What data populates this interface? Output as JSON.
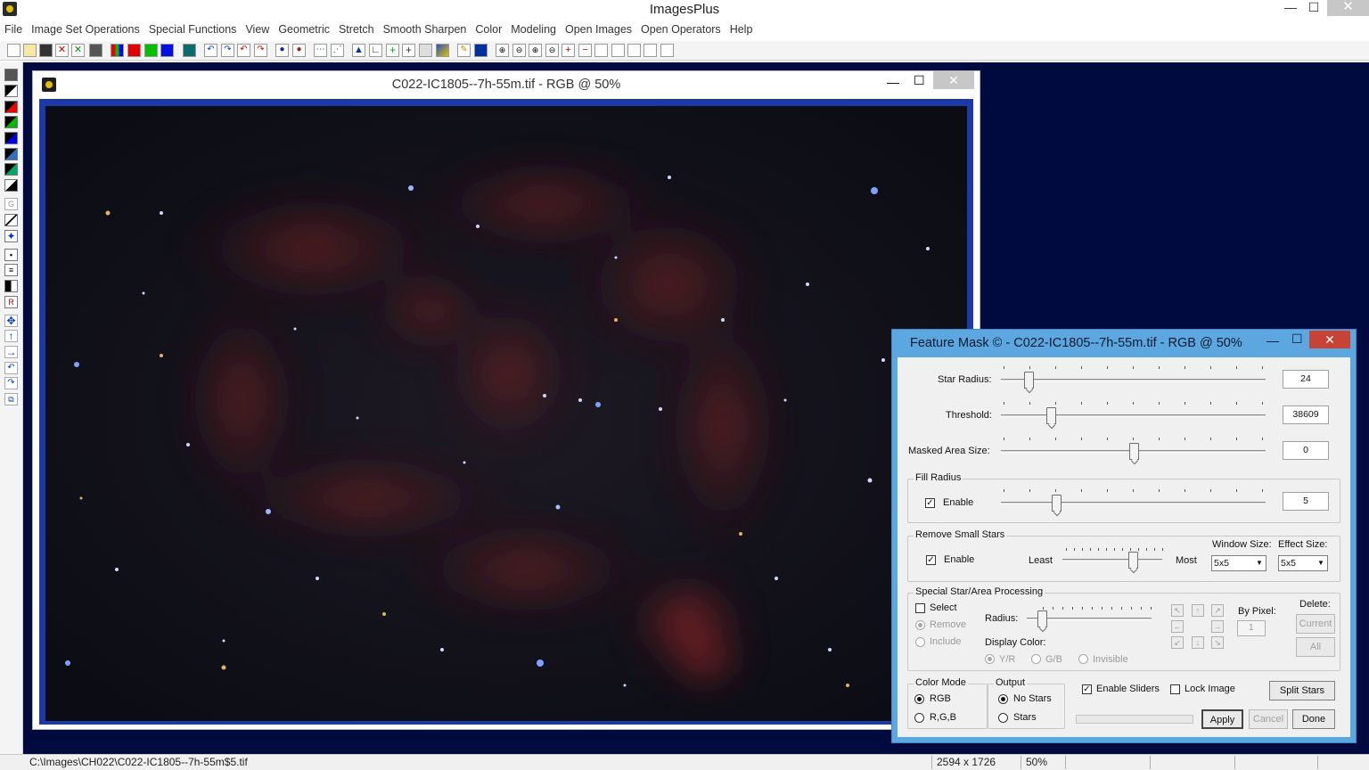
{
  "app": {
    "title": "ImagesPlus"
  },
  "menu": [
    "File",
    "Image Set Operations",
    "Special Functions",
    "View",
    "Geometric",
    "Stretch",
    "Smooth Sharpen",
    "Color",
    "Modeling",
    "Open Images",
    "Open Operators",
    "Help"
  ],
  "window_controls": {
    "minimize": "—",
    "maximize": "☐",
    "close": "✕"
  },
  "image_window": {
    "title": "C022-IC1805--7h-55m.tif - RGB @ 50%"
  },
  "feature_mask": {
    "title": "Feature Mask © - C022-IC1805--7h-55m.tif - RGB @ 50%",
    "star_radius": {
      "label": "Star Radius:",
      "value": "24"
    },
    "threshold": {
      "label": "Threshold:",
      "value": "38609"
    },
    "masked_area_size": {
      "label": "Masked Area Size:",
      "value": "0"
    },
    "fill_radius": {
      "group": "Fill Radius",
      "enable_label": "Enable",
      "value": "5"
    },
    "remove_small_stars": {
      "group": "Remove Small Stars",
      "enable_label": "Enable",
      "least_label": "Least",
      "most_label": "Most",
      "window_size_label": "Window Size:",
      "window_size_value": "5x5",
      "effect_size_label": "Effect Size:",
      "effect_size_value": "5x5"
    },
    "special": {
      "group": "Special Star/Area Processing",
      "select_label": "Select",
      "remove_label": "Remove",
      "include_label": "Include",
      "radius_label": "Radius:",
      "display_color_label": "Display Color:",
      "color_yr": "Y/R",
      "color_gb": "G/B",
      "color_invisible": "Invisible",
      "by_pixel_label": "By Pixel:",
      "by_pixel_value": "1",
      "delete_label": "Delete:",
      "current_button": "Current",
      "all_button": "All"
    },
    "color_mode": {
      "group": "Color Mode",
      "rgb": "RGB",
      "r_g_b": "R,G,B"
    },
    "output": {
      "group": "Output",
      "no_stars": "No Stars",
      "stars": "Stars"
    },
    "enable_sliders_label": "Enable Sliders",
    "lock_image_label": "Lock Image",
    "split_stars_button": "Split Stars",
    "apply_button": "Apply",
    "cancel_button": "Cancel",
    "done_button": "Done"
  },
  "status": {
    "path": "C:\\Images\\CH022\\C022-IC1805--7h-55m$5.tif",
    "dimensions": "2594 x 1726",
    "zoom": "50%"
  },
  "colors": {
    "workspace": "#000a3f",
    "dialog_frame": "#5da7e0",
    "image_border": "#1b3aa8",
    "close_red": "#c84235"
  }
}
